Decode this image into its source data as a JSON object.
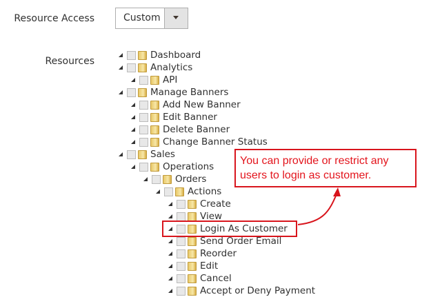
{
  "resource_access": {
    "label": "Resource Access",
    "value": "Custom"
  },
  "resources": {
    "label": "Resources",
    "items": [
      {
        "label": "Dashboard",
        "level": 0
      },
      {
        "label": "Analytics",
        "level": 0
      },
      {
        "label": "API",
        "level": 1
      },
      {
        "label": "Manage Banners",
        "level": 0
      },
      {
        "label": "Add New Banner",
        "level": 1
      },
      {
        "label": "Edit Banner",
        "level": 1
      },
      {
        "label": "Delete Banner",
        "level": 1
      },
      {
        "label": "Change Banner Status",
        "level": 1
      },
      {
        "label": "Sales",
        "level": 0
      },
      {
        "label": "Operations",
        "level": 1
      },
      {
        "label": "Orders",
        "level": 2
      },
      {
        "label": "Actions",
        "level": 3
      },
      {
        "label": "Create",
        "level": 4
      },
      {
        "label": "View",
        "level": 4
      },
      {
        "label": "Login As Customer",
        "level": 4
      },
      {
        "label": "Send Order Email",
        "level": 4
      },
      {
        "label": "Reorder",
        "level": 4
      },
      {
        "label": "Edit",
        "level": 4
      },
      {
        "label": "Cancel",
        "level": 4
      },
      {
        "label": "Accept or Deny Payment",
        "level": 4
      }
    ]
  },
  "callout": {
    "text": "You can provide or restrict any users to login as customer.",
    "color": "#e3141c"
  }
}
